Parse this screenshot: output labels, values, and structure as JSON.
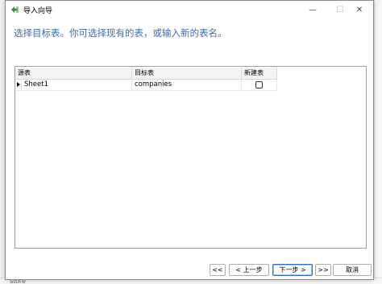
{
  "window": {
    "title": "导入向导",
    "minimize_glyph": "—",
    "maximize_glyph": "☐",
    "close_glyph": "✕"
  },
  "instruction": "选择目标表。你可选择现有的表，或输入新的表名。",
  "grid": {
    "columns": [
      "源表",
      "目标表",
      "新建表"
    ],
    "rows": [
      {
        "source": "Sheet1",
        "target": "companies",
        "create_new": false
      }
    ]
  },
  "buttons": {
    "first": "<<",
    "prev": "< 上一步",
    "next": "下一步 >",
    "last": ">>",
    "cancel": "取消"
  },
  "background_texts": {
    "bottom_left": "store"
  },
  "colors": {
    "instruction_text": "#3b6db8",
    "primary_button_border": "#2d6fc5",
    "app_icon": "#2e8b3a"
  }
}
